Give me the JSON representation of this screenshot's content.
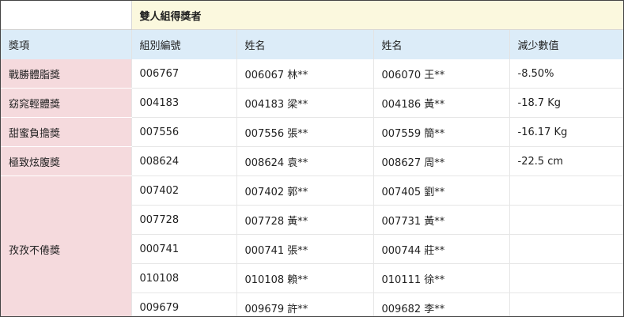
{
  "table": {
    "title": "雙人組得獎者",
    "headers": [
      "獎項",
      "組別編號",
      "姓名",
      "姓名",
      "減少數值"
    ],
    "rows": [
      {
        "category": "戰勝體脂獎",
        "group": "006767",
        "name1": "006067 林**",
        "name2": "006070 王**",
        "value": "-8.50%"
      },
      {
        "category": "窈窕輕體獎",
        "group": "004183",
        "name1": "004183 梁**",
        "name2": "004186 黃**",
        "value": "-18.7 Kg"
      },
      {
        "category": "甜蜜負擔獎",
        "group": "007556",
        "name1": "007556 張**",
        "name2": "007559 簡**",
        "value": "-16.17 Kg"
      },
      {
        "category": "極致炫腹獎",
        "group": "008624",
        "name1": "008624 袁**",
        "name2": "008627 周**",
        "value": "-22.5 cm"
      }
    ],
    "merged_category": "孜孜不倦獎",
    "merged_rows": [
      {
        "group": "007402",
        "name1": "007402 郭**",
        "name2": "007405 劉**",
        "value": ""
      },
      {
        "group": "007728",
        "name1": "007728 黃**",
        "name2": "007731 黃**",
        "value": ""
      },
      {
        "group": "000741",
        "name1": "000741 張**",
        "name2": "000744 莊**",
        "value": ""
      },
      {
        "group": "010108",
        "name1": "010108 賴**",
        "name2": "010111 徐**",
        "value": ""
      },
      {
        "group": "009679",
        "name1": "009679 許**",
        "name2": "009682 李**",
        "value": ""
      }
    ]
  }
}
